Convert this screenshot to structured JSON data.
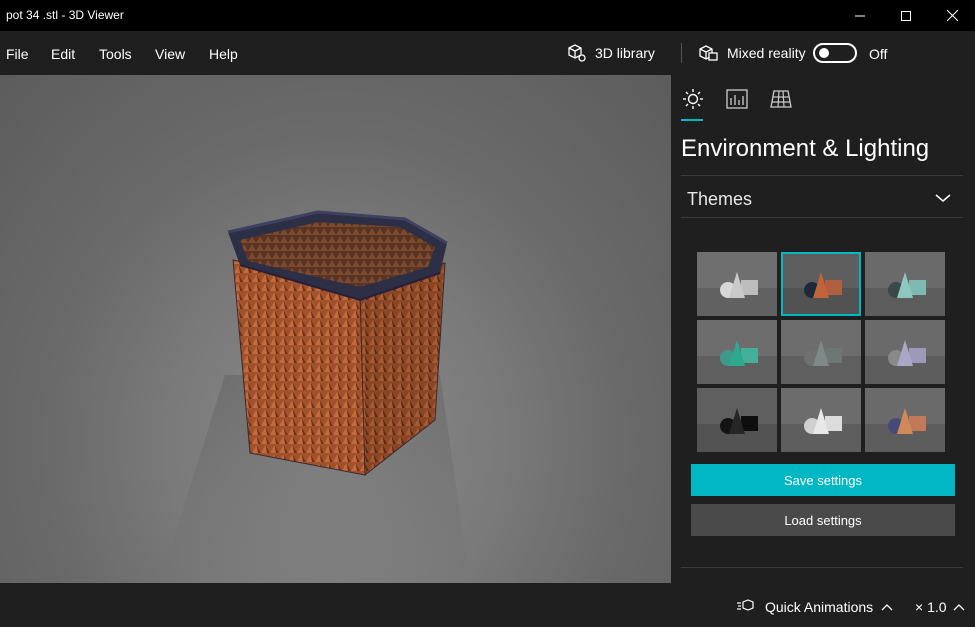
{
  "window": {
    "title": "pot 34 .stl - 3D Viewer",
    "minimize_glyph": "—",
    "maximize_glyph": "☐",
    "close_glyph": "✕"
  },
  "menu": {
    "items": [
      {
        "label": "File"
      },
      {
        "label": "Edit"
      },
      {
        "label": "Tools"
      },
      {
        "label": "View"
      },
      {
        "label": "Help"
      }
    ],
    "library_label": "3D library",
    "mixed_reality_label": "Mixed reality",
    "toggle_state": "Off"
  },
  "panel": {
    "tabs": [
      {
        "name": "environment-lighting",
        "icon": "sun-icon"
      },
      {
        "name": "stats-shading",
        "icon": "chart-icon"
      },
      {
        "name": "mesh-grid",
        "icon": "grid-icon"
      }
    ],
    "title": "Environment & Lighting",
    "themes_label": "Themes",
    "themes": [
      {
        "bg": "#6f6f6f",
        "a": "#d8d8d8",
        "b": "#c9c9c9",
        "c": "#bdbdbd"
      },
      {
        "bg": "#5e5e5e",
        "a": "#1e2a3a",
        "b": "#c0643a",
        "c": "#b06040"
      },
      {
        "bg": "#6a6a6a",
        "a": "#3a4848",
        "b": "#8cc8bf",
        "c": "#7fbab2"
      },
      {
        "bg": "#6d6d6d",
        "a": "#3d9a8a",
        "b": "#2fa890",
        "c": "#45b09a"
      },
      {
        "bg": "#6d6d6d",
        "a": "#707070",
        "b": "#7f8a88",
        "c": "#6e7774"
      },
      {
        "bg": "#6a6a6a",
        "a": "#8a8a8a",
        "b": "#a9a6c6",
        "c": "#9c99b9"
      },
      {
        "bg": "#5f5f5f",
        "a": "#141414",
        "b": "#262626",
        "c": "#0e0e0e"
      },
      {
        "bg": "#6c6c6c",
        "a": "#d0d0d0",
        "b": "#e8e8e8",
        "c": "#dcdcdc"
      },
      {
        "bg": "#6a6a6a",
        "a": "#4a4a7a",
        "b": "#d08a5a",
        "c": "#c07a5a"
      }
    ],
    "selected_theme_index": 1,
    "save_label": "Save settings",
    "load_label": "Load settings"
  },
  "status": {
    "quick_animations_label": "Quick Animations",
    "speed": "× 1.0"
  },
  "colors": {
    "accent": "#00b7c3",
    "model": "#a0522d"
  }
}
